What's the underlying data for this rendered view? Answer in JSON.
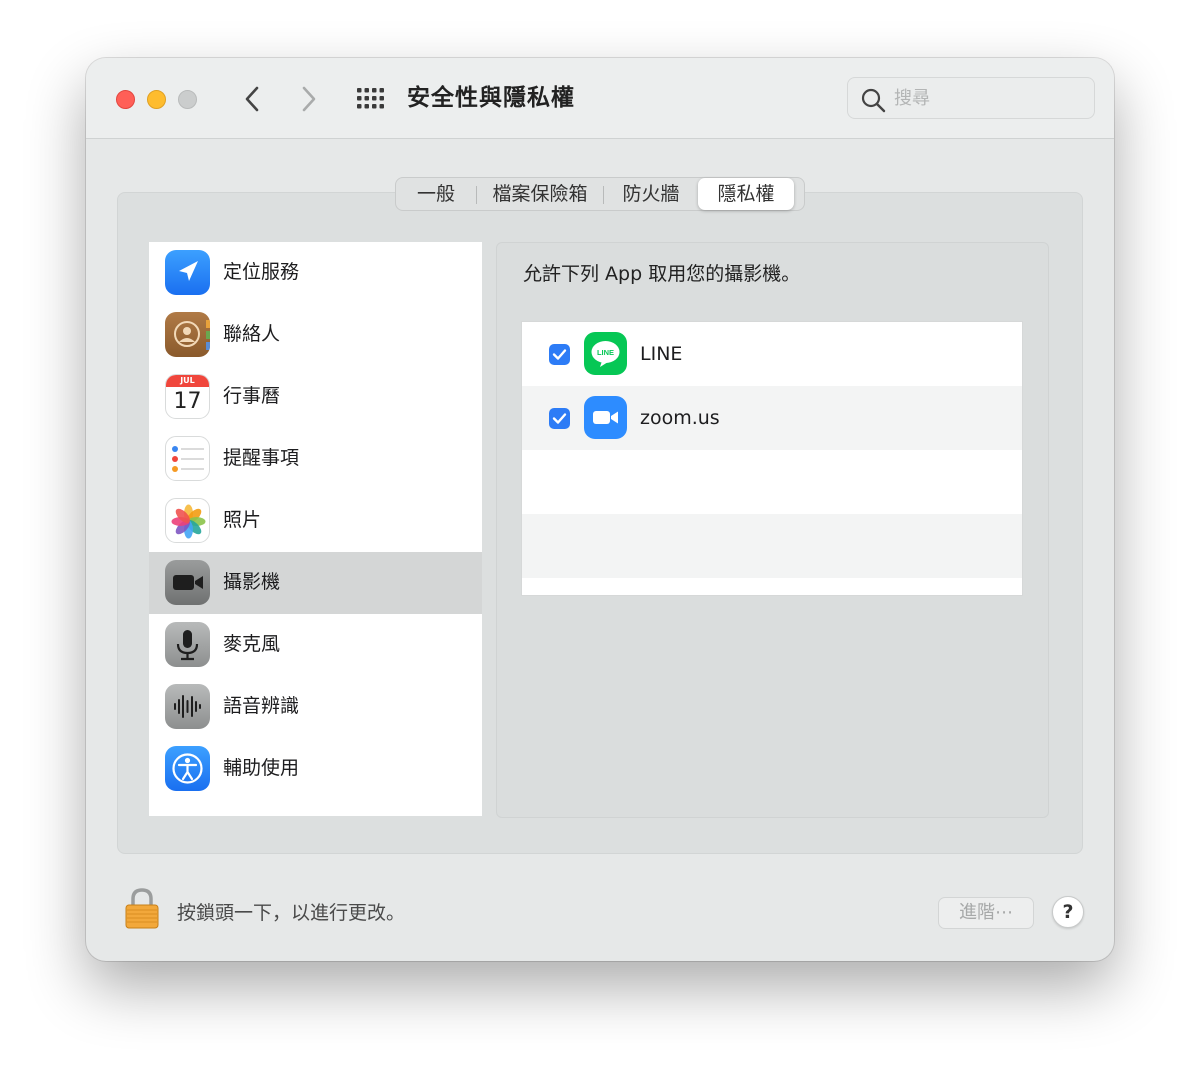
{
  "window": {
    "title": "安全性與隱私權",
    "search_placeholder": "搜尋"
  },
  "tabs": [
    {
      "label": "一般",
      "selected": false
    },
    {
      "label": "檔案保險箱",
      "selected": false
    },
    {
      "label": "防火牆",
      "selected": false
    },
    {
      "label": "隱私權",
      "selected": true
    }
  ],
  "sidebar": {
    "items": [
      {
        "label": "定位服務",
        "icon": "location-icon"
      },
      {
        "label": "聯絡人",
        "icon": "contacts-icon"
      },
      {
        "label": "行事曆",
        "icon": "calendar-icon",
        "icon_month": "JUL",
        "icon_day": "17"
      },
      {
        "label": "提醒事項",
        "icon": "reminders-icon"
      },
      {
        "label": "照片",
        "icon": "photos-icon"
      },
      {
        "label": "攝影機",
        "icon": "camera-icon",
        "selected": true
      },
      {
        "label": "麥克風",
        "icon": "microphone-icon"
      },
      {
        "label": "語音辨識",
        "icon": "speech-recognition-icon"
      },
      {
        "label": "輔助使用",
        "icon": "accessibility-icon"
      }
    ]
  },
  "main": {
    "title": "允許下列 App 取用您的攝影機。",
    "apps": [
      {
        "name": "LINE",
        "checked": true,
        "icon": "line-app-icon",
        "icon_text": "LINE"
      },
      {
        "name": "zoom.us",
        "checked": true,
        "icon": "zoom-app-icon"
      }
    ]
  },
  "footer": {
    "lock_text": "按鎖頭一下，以進行更改。",
    "advanced_label": "進階⋯",
    "help_label": "?"
  },
  "colors": {
    "accent": "#2d7cf6",
    "close": "#ff5f57",
    "minimize": "#febc2e",
    "line_green": "#06c755",
    "zoom_blue": "#2d8cff"
  }
}
